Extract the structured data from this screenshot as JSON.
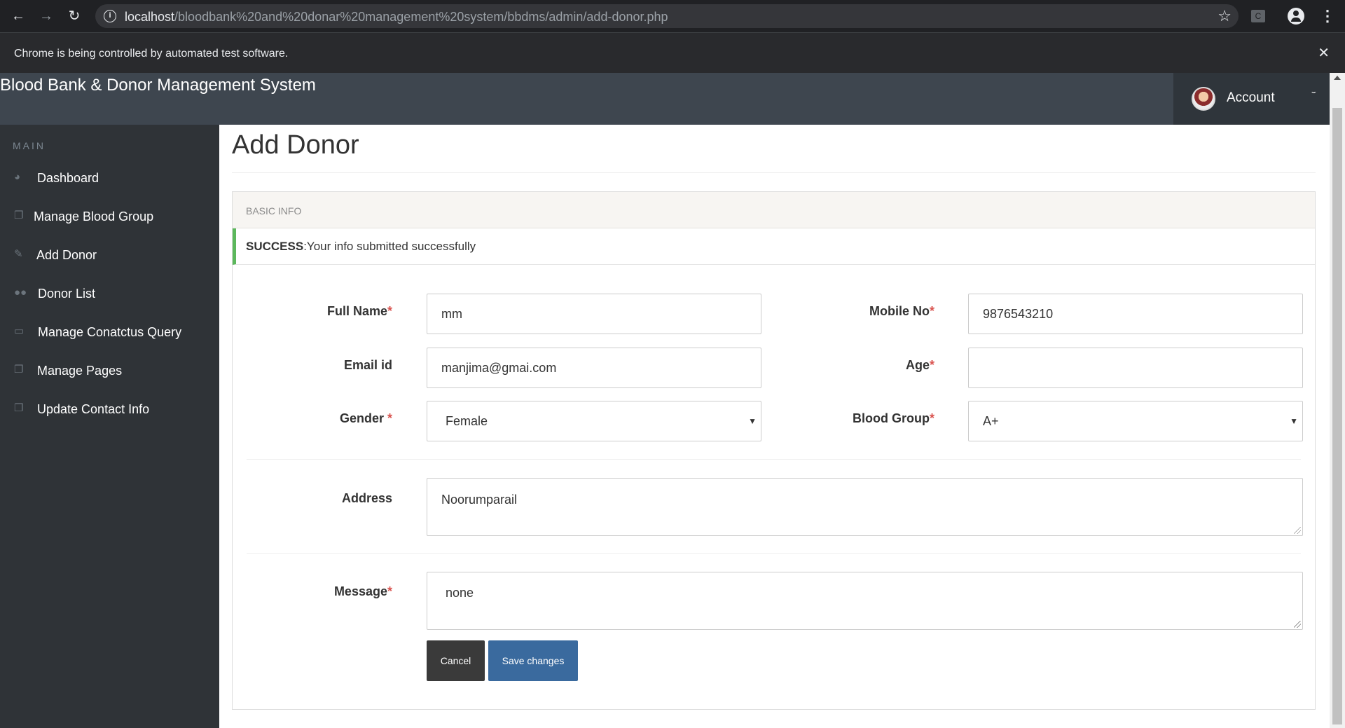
{
  "browser": {
    "url_host": "localhost",
    "url_path": "/bloodbank%20and%20donar%20management%20system/bbdms/admin/add-donor.php",
    "info_icon": "i",
    "ext_label": "C",
    "automation_notice": "Chrome is being controlled by automated test software."
  },
  "app": {
    "brand": "Blood Bank & Donor Management System",
    "account_label": "Account"
  },
  "sidebar": {
    "heading": "MAIN",
    "items": [
      {
        "label": "Dashboard",
        "icon": "dashboard-icon"
      },
      {
        "label": "Manage Blood Group",
        "icon": "copy-icon"
      },
      {
        "label": "Add Donor",
        "icon": "edit-icon"
      },
      {
        "label": "Donor List",
        "icon": "users-icon"
      },
      {
        "label": "Manage Conatctus Query",
        "icon": "desktop-icon"
      },
      {
        "label": "Manage Pages",
        "icon": "copy-icon"
      },
      {
        "label": "Update Contact Info",
        "icon": "copy-icon"
      }
    ]
  },
  "page": {
    "title": "Add Donor",
    "panel_heading": "BASIC INFO",
    "alert_strong": "SUCCESS",
    "alert_text": ":Your info submitted successfully"
  },
  "form": {
    "full_name": {
      "label": "Full Name",
      "value": "mm"
    },
    "mobile": {
      "label": "Mobile No",
      "value": "9876543210"
    },
    "email": {
      "label": "Email id",
      "value": "manjima@gmai.com"
    },
    "age": {
      "label": "Age",
      "value": ""
    },
    "gender": {
      "label": "Gender ",
      "value": "Female"
    },
    "blood_group": {
      "label": "Blood Group",
      "value": "A+"
    },
    "address": {
      "label": "Address",
      "value": "Noorumparail"
    },
    "message": {
      "label": "Message",
      "value": "none"
    },
    "required_mark": "*"
  },
  "buttons": {
    "cancel": "Cancel",
    "save": "Save changes"
  },
  "colors": {
    "header_bg": "#3e464f",
    "sidebar_bg": "#2f3337",
    "success_accent": "#5cb85c",
    "save_button": "#3a6a9e",
    "required": "#d9534f"
  }
}
